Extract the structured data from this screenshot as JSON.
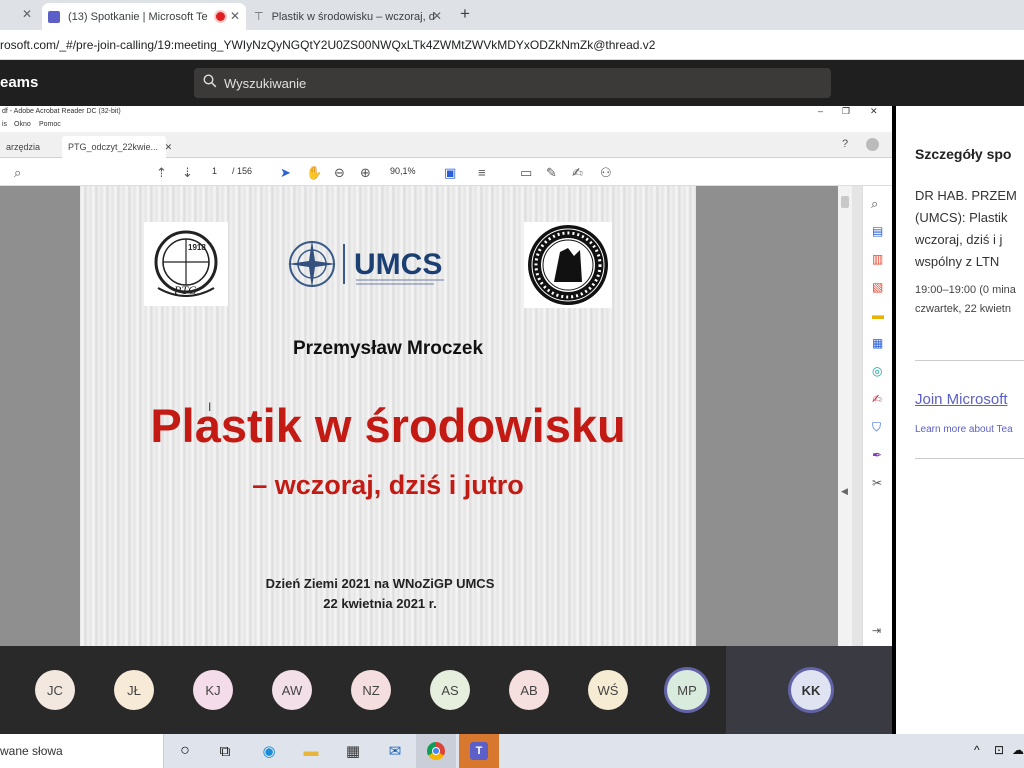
{
  "browser": {
    "tabs": [
      {
        "label": "(13) Spotkanie | Microsoft Te"
      },
      {
        "label": "Plastik w środowisku – wczoraj, d"
      }
    ],
    "url": "rosoft.com/_#/pre-join-calling/19:meeting_YWIyNzQyNGQtY2U0ZS00NWQxLTk4ZWMtZWVkMDYxODZkNmZk@thread.v2"
  },
  "teams": {
    "app_name": "eams",
    "search_placeholder": "Wyszukiwanie"
  },
  "acrobat": {
    "window_title": "df - Adobe Acrobat Reader DC (32-bit)",
    "menu": [
      "is",
      "Okno",
      "Pomoc"
    ],
    "tabs": [
      "arzędzia",
      "PTG_odczyt_22kwie..."
    ],
    "page_current": "1",
    "page_total": "/ 156",
    "zoom": "90,1%"
  },
  "slide": {
    "logo_umcs": "UMCS",
    "logo_ptg_year": "1918",
    "logo_ptg": "PTG",
    "author": "Przemysław Mroczek",
    "title": "Plastik w środowisku",
    "subtitle": "– wczoraj, dziś i jutro",
    "event": "Dzień Ziemi 2021 na WNoZiGP UMCS",
    "date": "22 kwietnia 2021 r."
  },
  "details": {
    "heading": "Szczegóły spo",
    "desc_lines": [
      "DR HAB. PRZEM",
      "(UMCS): Plastik",
      "wczoraj, dziś i j",
      "wspólny z LTN"
    ],
    "time": "19:00–19:00 (0 mina",
    "day": "czwartek, 22 kwietn",
    "join_link": "Join Microsoft",
    "learn_more": "Learn more about Tea"
  },
  "participants": [
    {
      "initials": "JC",
      "color": "#f3e8e0"
    },
    {
      "initials": "JŁ",
      "color": "#f7ead7"
    },
    {
      "initials": "KJ",
      "color": "#f5dcea"
    },
    {
      "initials": "AW",
      "color": "#f2dfe8"
    },
    {
      "initials": "NZ",
      "color": "#f5dedf"
    },
    {
      "initials": "AS",
      "color": "#e6eedd"
    },
    {
      "initials": "AB",
      "color": "#f6e0df"
    },
    {
      "initials": "WŚ",
      "color": "#f6ecd3"
    },
    {
      "initials": "MP",
      "color": "#d8ebdc"
    },
    {
      "initials": "KK",
      "color": "#dfe3f2"
    }
  ],
  "taskbar": {
    "search_text": "wane słowa"
  }
}
